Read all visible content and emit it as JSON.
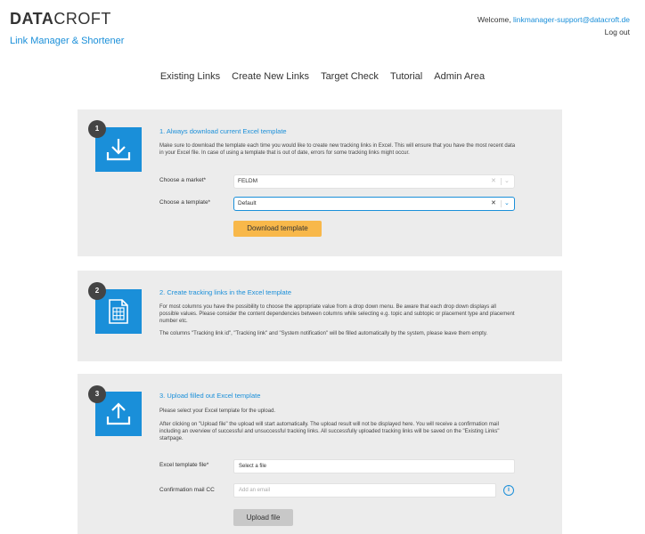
{
  "brand": {
    "logo_bold": "DATA",
    "logo_rest": "CROFT",
    "subtitle": "Link Manager & Shortener"
  },
  "user": {
    "welcome": "Welcome, ",
    "email": "linkmanager-support@datacroft.de",
    "logout": "Log out"
  },
  "nav": [
    "Existing Links",
    "Create New Links",
    "Target Check",
    "Tutorial",
    "Admin Area"
  ],
  "step1": {
    "number": "1",
    "title": "1. Always download current Excel template",
    "text": "Make sure to download the template each time you would like to create new tracking links in Excel. This will ensure that you have the most recent data in your Excel file. In case of using a template that is out of date, errors for some tracking links might occur.",
    "market_label": "Choose a market*",
    "market_value": "FELDM",
    "template_label": "Choose a template*",
    "template_value": "Default",
    "download_button": "Download template"
  },
  "step2": {
    "number": "2",
    "title": "2. Create tracking links in the Excel template",
    "text1": "For most columns you have the possibility to choose the appropriate value from a drop down menu. Be aware that each drop down displays all possible values. Please consider the content dependencies between columns while selecting e.g. topic and subtopic or placement type and placement number etc.",
    "text2": "The columns \"Tracking link id\", \"Tracking link\" and \"System notification\" will be filled automatically by the system, please leave them empty."
  },
  "step3": {
    "number": "3",
    "title": "3. Upload filled out Excel template",
    "text1": "Please select your Excel template for the upload.",
    "text2": "After clicking on \"Upload file\" the upload will start automatically. The upload result will not be displayed here. You will receive a confirmation mail including an overview of successful and unsuccessful tracking links. All successfully uploaded tracking links will be saved on the \"Existing Links\" startpage.",
    "file_label": "Excel template file*",
    "file_value": "Select a file",
    "mail_label": "Confirmation mail CC",
    "mail_placeholder": "Add an email",
    "upload_button": "Upload file"
  },
  "colors": {
    "accent": "#1a8fd9",
    "button_primary": "#f8b84a",
    "card_bg": "#ececec",
    "badge": "#444444"
  },
  "icons": [
    "download-icon",
    "spreadsheet-icon",
    "upload-icon",
    "info-icon",
    "clear-icon",
    "chevron-down-icon"
  ]
}
